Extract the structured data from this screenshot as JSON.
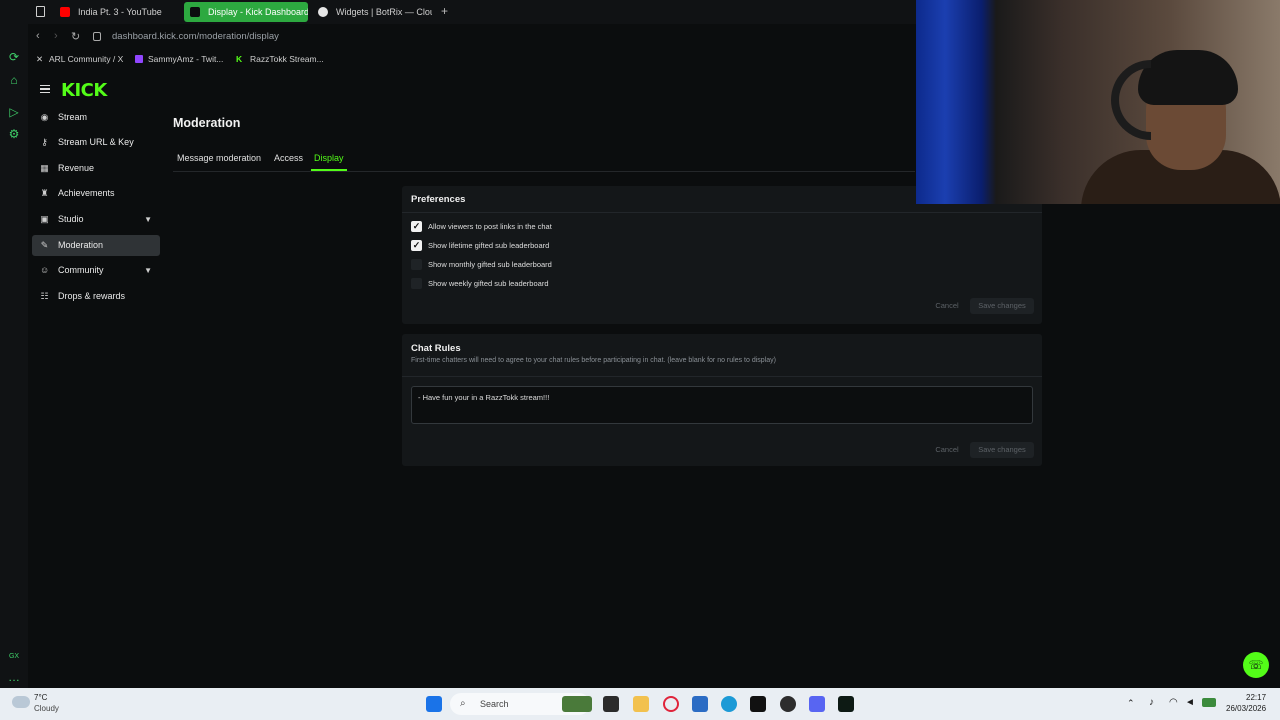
{
  "browser": {
    "tabs": [
      {
        "label": "India Pt. 3 - YouTube",
        "active": false
      },
      {
        "label": "Display - Kick Dashboard",
        "active": true
      },
      {
        "label": "Widgets | BotRix — Cloud",
        "active": false
      }
    ],
    "url": "dashboard.kick.com/moderation/display",
    "bookmarks": [
      "ARL Community / X",
      "SammyAmz - Twit...",
      "RazzTokk Stream..."
    ]
  },
  "sidebar": {
    "logo": "KICK",
    "items": [
      {
        "label": "Stream",
        "icon": "broadcast-icon"
      },
      {
        "label": "Stream URL & Key",
        "icon": "key-icon"
      },
      {
        "label": "Revenue",
        "icon": "chart-icon"
      },
      {
        "label": "Achievements",
        "icon": "trophy-icon"
      },
      {
        "label": "Studio",
        "icon": "grid-icon",
        "expandable": true
      },
      {
        "label": "Moderation",
        "icon": "wrench-icon",
        "active": true
      },
      {
        "label": "Community",
        "icon": "people-icon",
        "expandable": true
      },
      {
        "label": "Drops & rewards",
        "icon": "gift-icon"
      }
    ]
  },
  "main": {
    "title": "Moderation",
    "tabs": [
      "Message moderation",
      "Access",
      "Display"
    ],
    "active_tab": "Display"
  },
  "preferences": {
    "title": "Preferences",
    "options": [
      {
        "label": "Allow viewers to post links in the chat",
        "checked": true
      },
      {
        "label": "Show lifetime gifted sub leaderboard",
        "checked": true
      },
      {
        "label": "Show monthly gifted sub leaderboard",
        "checked": false
      },
      {
        "label": "Show weekly gifted sub leaderboard",
        "checked": false
      }
    ],
    "cancel_label": "Cancel",
    "save_label": "Save changes"
  },
  "chat_rules": {
    "title": "Chat Rules",
    "description": "First-time chatters will need to agree to your chat rules before participating in chat. (leave blank for no rules to display)",
    "value": "- Have fun your in a RazzTokk stream!!!",
    "cancel_label": "Cancel",
    "save_label": "Save changes"
  },
  "taskbar": {
    "weather_temp": "7°C",
    "weather_desc": "Cloudy",
    "search_label": "Search",
    "time": "22:17",
    "date": "26/03/2026"
  },
  "colors": {
    "accent": "#53fc18",
    "background": "#0b0d0e",
    "card": "#141719"
  }
}
